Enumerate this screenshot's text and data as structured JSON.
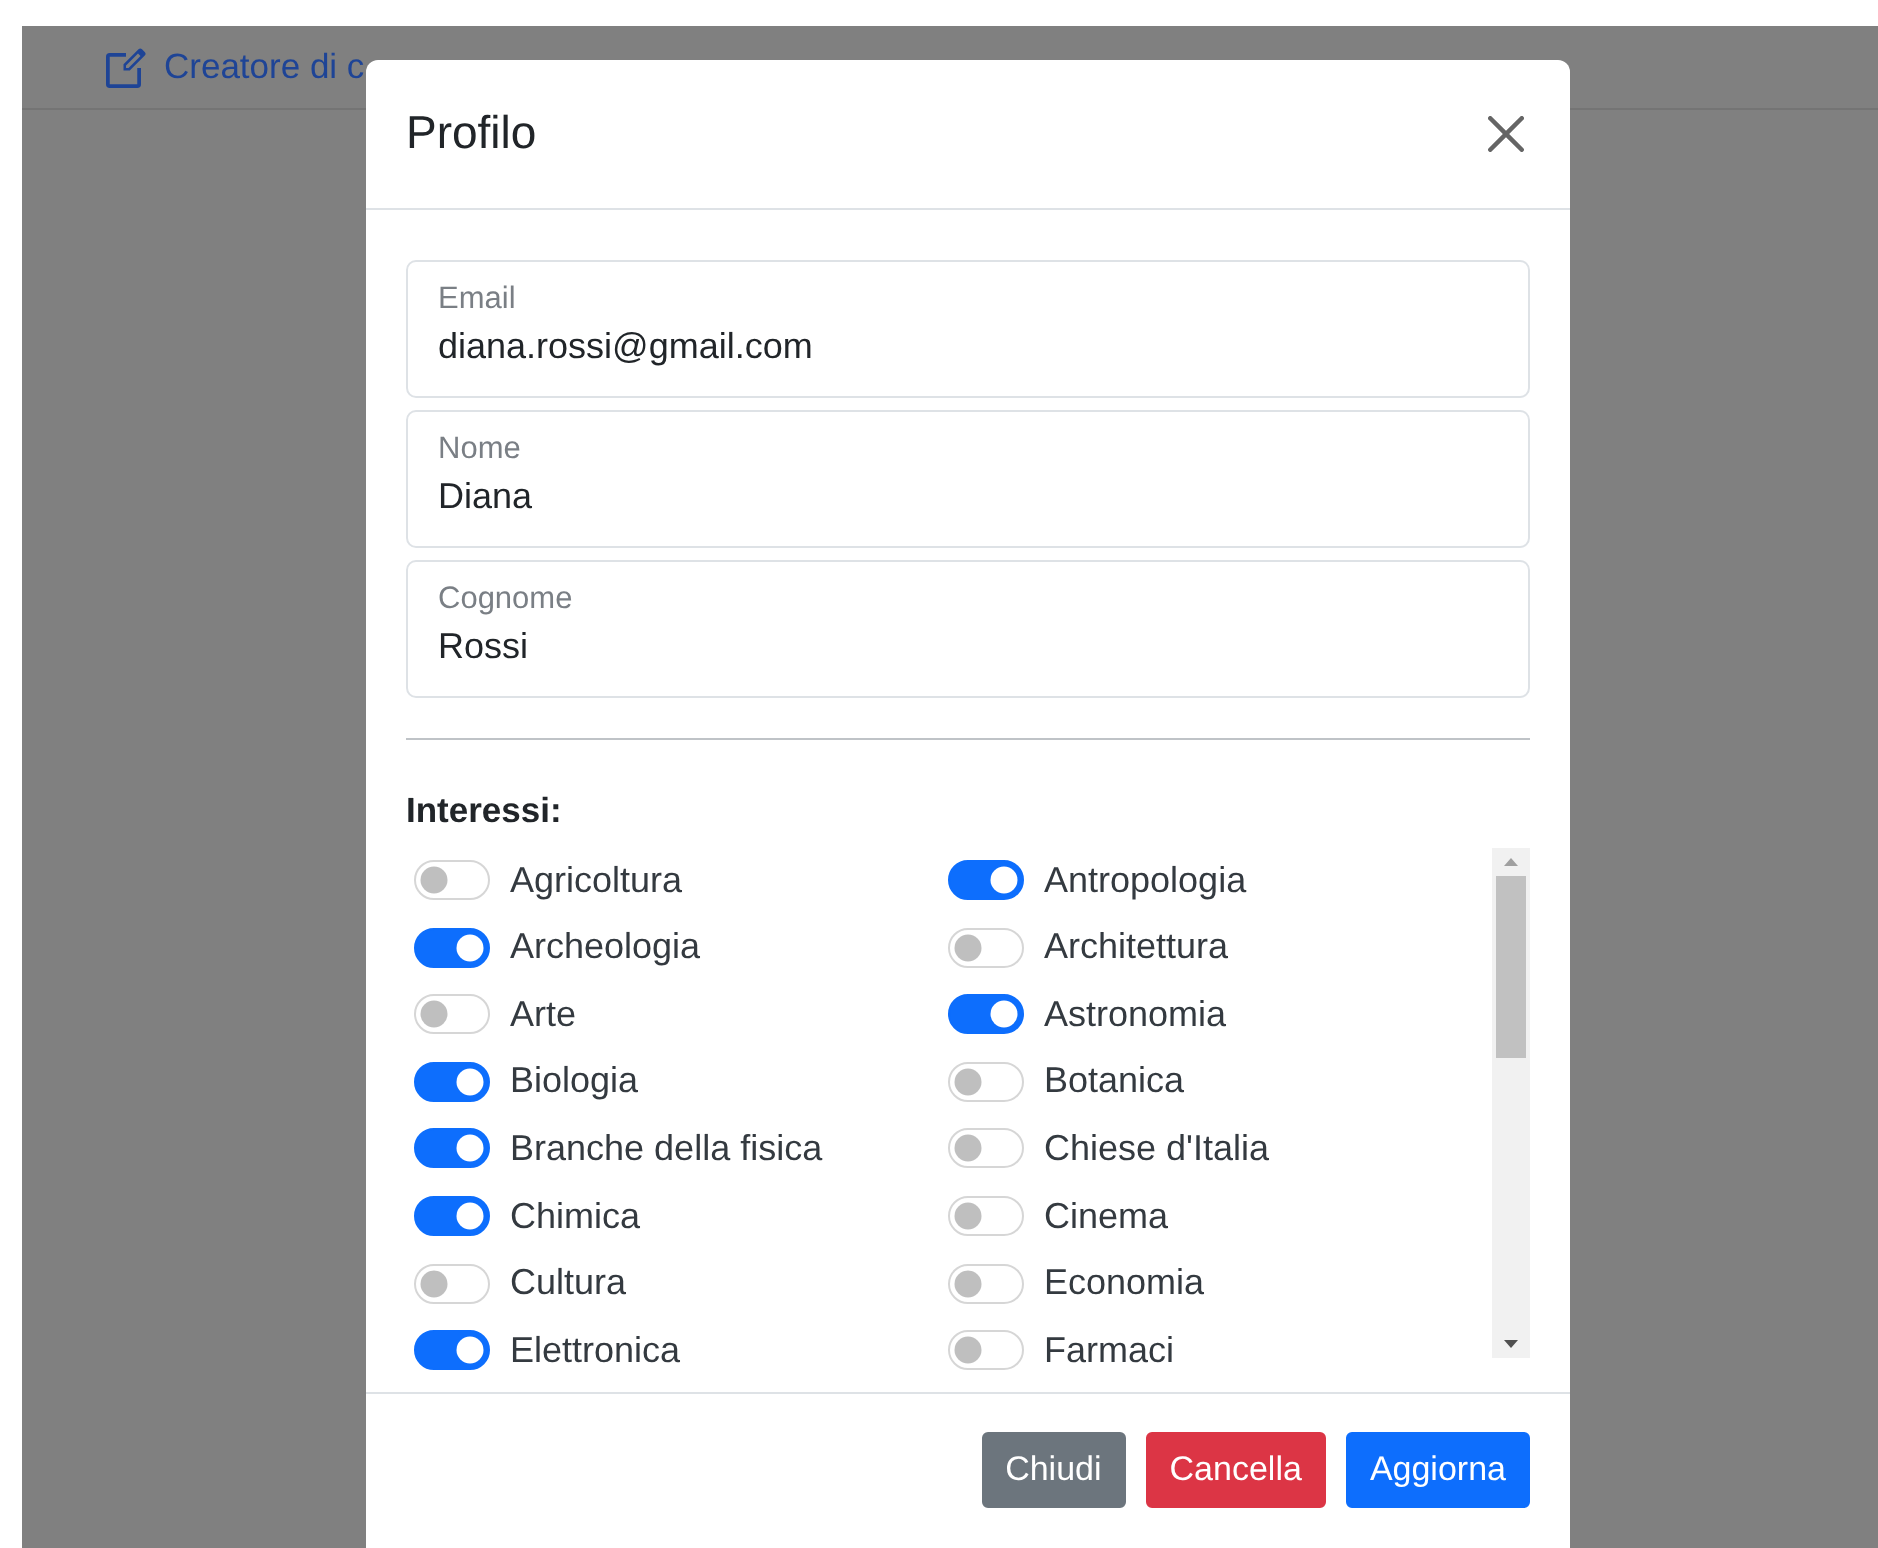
{
  "navbar": {
    "brand": "Creatore di c"
  },
  "modal": {
    "title": "Profilo",
    "fields": [
      {
        "label": "Email",
        "value": "diana.rossi@gmail.com"
      },
      {
        "label": "Nome",
        "value": "Diana"
      },
      {
        "label": "Cognome",
        "value": "Rossi"
      }
    ],
    "interests_label": "Interessi:",
    "interests": [
      {
        "label": "Agricoltura",
        "on": false
      },
      {
        "label": "Antropologia",
        "on": true
      },
      {
        "label": "Archeologia",
        "on": true
      },
      {
        "label": "Architettura",
        "on": false
      },
      {
        "label": "Arte",
        "on": false
      },
      {
        "label": "Astronomia",
        "on": true
      },
      {
        "label": "Biologia",
        "on": true
      },
      {
        "label": "Botanica",
        "on": false
      },
      {
        "label": "Branche della fisica",
        "on": true
      },
      {
        "label": "Chiese d'Italia",
        "on": false
      },
      {
        "label": "Chimica",
        "on": true
      },
      {
        "label": "Cinema",
        "on": false
      },
      {
        "label": "Cultura",
        "on": false
      },
      {
        "label": "Economia",
        "on": false
      },
      {
        "label": "Elettronica",
        "on": true
      },
      {
        "label": "Farmaci",
        "on": false
      }
    ],
    "buttons": [
      {
        "label": "Chiudi",
        "kind": "secondary"
      },
      {
        "label": "Cancella",
        "kind": "danger"
      },
      {
        "label": "Aggiorna",
        "kind": "primary"
      }
    ]
  }
}
